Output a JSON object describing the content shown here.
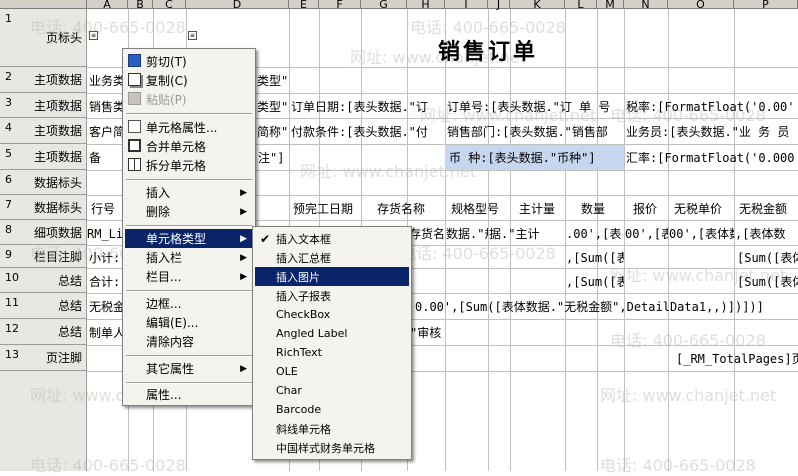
{
  "columns": [
    "A",
    "B",
    "C",
    "D",
    "E",
    "F",
    "G",
    "H",
    "I",
    "J",
    "K",
    "L",
    "M",
    "N",
    "O",
    "P"
  ],
  "rows": [
    {
      "num": "1",
      "label": "页标头"
    },
    {
      "num": "2",
      "label": "主项数据"
    },
    {
      "num": "3",
      "label": "主项数据"
    },
    {
      "num": "4",
      "label": "主项数据"
    },
    {
      "num": "5",
      "label": "主项数据"
    },
    {
      "num": "6",
      "label": "数据标头"
    },
    {
      "num": "7",
      "label": "数据标头"
    },
    {
      "num": "8",
      "label": "细项数据"
    },
    {
      "num": "9",
      "label": "栏目注脚"
    },
    {
      "num": "10",
      "label": "总结"
    },
    {
      "num": "11",
      "label": "总结"
    },
    {
      "num": "12",
      "label": "总结"
    },
    {
      "num": "13",
      "label": "页注脚"
    }
  ],
  "report_title": "销售订单",
  "cells": {
    "r2_a": "业务类",
    "r2_d": "类型\"",
    "r3_a": "销售类",
    "r3_d": "类型\"",
    "r3_e": "订单日期:[表头数据.\"订",
    "r3_i": "订单号:[表头数据.\"订 单 号",
    "r3_o": "税率:[FormatFloat('0.00'",
    "r4_a": "客户简",
    "r4_d": "简称\"",
    "r4_e": "付款条件:[表头数据.\"付",
    "r4_i": "销售部门:[表头数据.\"销售部",
    "r4_o": "业务员:[表头数据.\"业 务 员",
    "r5_a": "备",
    "r5_d": "注\"]",
    "r5_i": "币  种:[表头数据.\"币种\"]",
    "r5_o": "汇率:[FormatFloat('0.000",
    "r7_a": "行号",
    "r7_e": "预完工日期",
    "r7_g": "存货名称",
    "r7_i": "规格型号",
    "r7_k": "主计量",
    "r7_l": "数量",
    "r7_n": "报价",
    "r7_o": "无税单价",
    "r7_p": "无税金额",
    "r8_a": "RM_Lin",
    "r8_g": "存货名",
    "r8_i": "数据.\"规格",
    "r8_j": "据.\"主计",
    "r8_l": ".00',[表",
    "r8_n": "00',[表",
    "r8_o": "00',[表体数",
    "r8_p": ",[表体数",
    "r9_a": "小计:",
    "r9_l": ",[Sum([表",
    "r9_p": "[Sum([表体",
    "r10_a": "合计:",
    "r10_l": ",[Sum([表",
    "r10_p": "[Sum([表体",
    "r11_a": "无税金",
    "r11_h": "0.00',[Sum([表体数据.\"无税金额\",DetailData1,,)])])]",
    "r12_a": "制单人",
    "r12_h": "\"审核",
    "r13_o": "[_RM_TotalPages]页"
  },
  "watermarks": [
    "电话: 400-665-0028",
    "网址: www.chanjet.net"
  ],
  "context_menu": {
    "items": [
      {
        "label": "剪切(T)",
        "icon": "cut-icon",
        "disabled": false
      },
      {
        "label": "复制(C)",
        "icon": "copy-icon",
        "disabled": false
      },
      {
        "label": "粘贴(P)",
        "icon": "paste-icon",
        "disabled": true
      },
      {
        "label": "单元格属性...",
        "icon": "cell-properties-icon",
        "disabled": false
      },
      {
        "label": "合并单元格",
        "icon": "merge-cells-icon",
        "disabled": false
      },
      {
        "label": "拆分单元格",
        "icon": "split-cells-icon",
        "disabled": false
      },
      {
        "label": "插入",
        "submenu": true
      },
      {
        "label": "删除",
        "submenu": true
      },
      {
        "label": "单元格类型",
        "submenu": true,
        "selected": true
      },
      {
        "label": "插入栏",
        "submenu": true
      },
      {
        "label": "栏目...",
        "submenu": true
      },
      {
        "label": "边框..."
      },
      {
        "label": "编辑(E)..."
      },
      {
        "label": "清除内容"
      },
      {
        "label": "其它属性",
        "submenu": true
      },
      {
        "label": "属性..."
      }
    ]
  },
  "submenu": {
    "items": [
      {
        "label": "插入文本框",
        "checked": true
      },
      {
        "label": "插入汇总框"
      },
      {
        "label": "插入图片",
        "selected": true
      },
      {
        "label": "插入子报表"
      },
      {
        "label": "CheckBox"
      },
      {
        "label": "Angled Label"
      },
      {
        "label": "RichText"
      },
      {
        "label": "OLE"
      },
      {
        "label": "Char"
      },
      {
        "label": "Barcode"
      },
      {
        "label": "斜线单元格"
      },
      {
        "label": "中国样式财务单元格"
      }
    ]
  },
  "colors": {
    "header_bg": "#d4d0c8",
    "selection": "#0a246a",
    "menu_bg": "#f4f3ee",
    "highlight_cell": "#c6d6ee"
  }
}
